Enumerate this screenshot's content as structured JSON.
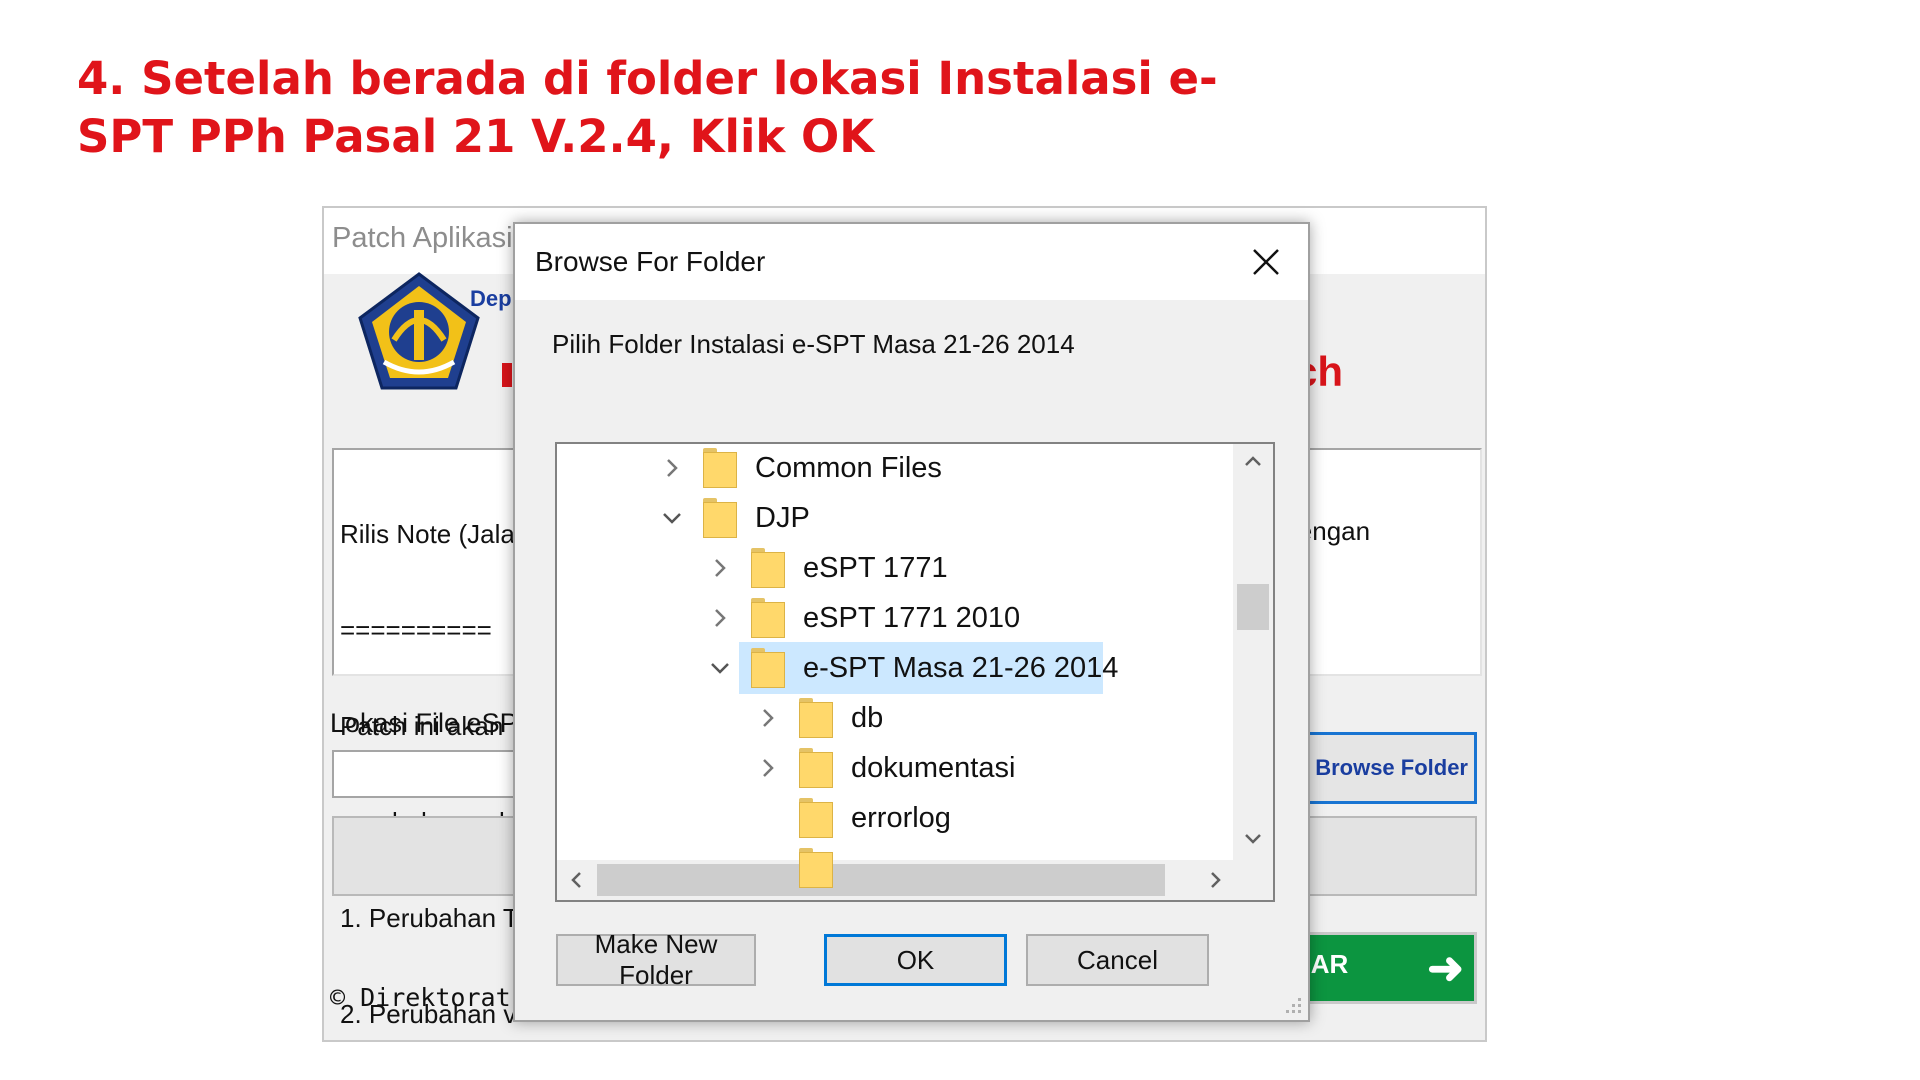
{
  "instruction": {
    "line1": "4. Setelah berada di folder lokasi Instalasi e-",
    "line2": "SPT PPh Pasal 21 V.2.4, Klik OK"
  },
  "background_app": {
    "title": "Patch Aplikasi",
    "dept_text": "Dep",
    "title_fragment": "ch",
    "release_notes_lines": [
      "Rilis Note (Jala",
      "==========",
      "Patch ini akan",
      "perubahan seb",
      "1. Perubahan T",
      "2. Perubahan v"
    ],
    "notes_right_fragment": "lengan",
    "location_label": "Lokasi File eSP",
    "browse_button": "Browse Folder",
    "exit_button": "UAR",
    "copyright": "© Direktorat"
  },
  "dialog": {
    "title": "Browse For Folder",
    "description": "Pilih Folder Instalasi e-SPT Masa 21-26 2014",
    "tree": [
      {
        "label": "Common Files",
        "expander": "collapsed",
        "level": 0,
        "selected": false
      },
      {
        "label": "DJP",
        "expander": "expanded",
        "level": 0,
        "selected": false
      },
      {
        "label": "eSPT 1771",
        "expander": "collapsed",
        "level": 1,
        "selected": false
      },
      {
        "label": "eSPT 1771 2010",
        "expander": "collapsed",
        "level": 1,
        "selected": false
      },
      {
        "label": "e-SPT Masa 21-26 2014",
        "expander": "expanded",
        "level": 1,
        "selected": true
      },
      {
        "label": "db",
        "expander": "collapsed",
        "level": 2,
        "selected": false
      },
      {
        "label": "dokumentasi",
        "expander": "collapsed",
        "level": 2,
        "selected": false
      },
      {
        "label": "errorlog",
        "expander": "none",
        "level": 2,
        "selected": false
      }
    ],
    "buttons": {
      "make_new_folder": "Make New Folder",
      "ok": "OK",
      "cancel": "Cancel"
    }
  },
  "colors": {
    "instruction_red": "#e0141a",
    "selection": "#cce8ff",
    "folder_yellow": "#ffd86b",
    "default_button_border": "#0078d7"
  }
}
